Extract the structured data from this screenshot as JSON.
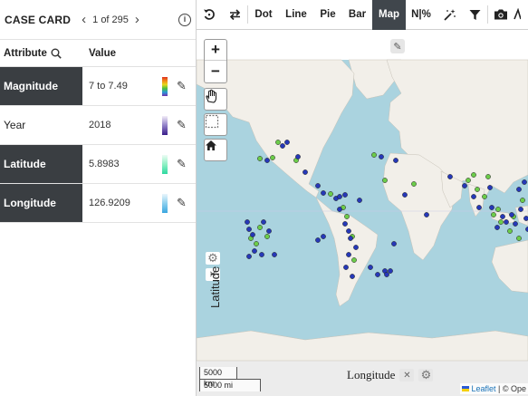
{
  "card": {
    "title": "CASE CARD",
    "prev_icon": "chevron-left-icon",
    "next_icon": "chevron-right-icon",
    "count": "1 of 295",
    "info_icon": "info-icon",
    "col_attribute": "Attribute",
    "col_value": "Value",
    "rows": [
      {
        "label": "Magnitude",
        "value": "7 to 7.49",
        "legend": "rainbow"
      },
      {
        "label": "Year",
        "value": "2018",
        "legend": "purple"
      },
      {
        "label": "Latitude",
        "value": "5.8983",
        "legend": "mint"
      },
      {
        "label": "Longitude",
        "value": "126.9209",
        "legend": "sky"
      }
    ]
  },
  "toolbar": {
    "items": [
      "Dot",
      "Line",
      "Pie",
      "Bar",
      "Map",
      "N|%"
    ],
    "active": "Map",
    "icons": [
      "undo-icon",
      "swap-icon",
      "magic-wand-icon",
      "filter-icon",
      "camera-icon"
    ]
  },
  "map": {
    "x_axis_label": "Longitude",
    "y_axis_label": "Latitude",
    "scale_km": "5000 km",
    "scale_mi": "5000 mi",
    "attribution_link": "Leaflet",
    "attribution_rest": "| © Ope",
    "colors": {
      "water": "#aad3df",
      "land": "#f2efe9",
      "green": "#6ccc4a",
      "blue": "#2638b8"
    }
  }
}
